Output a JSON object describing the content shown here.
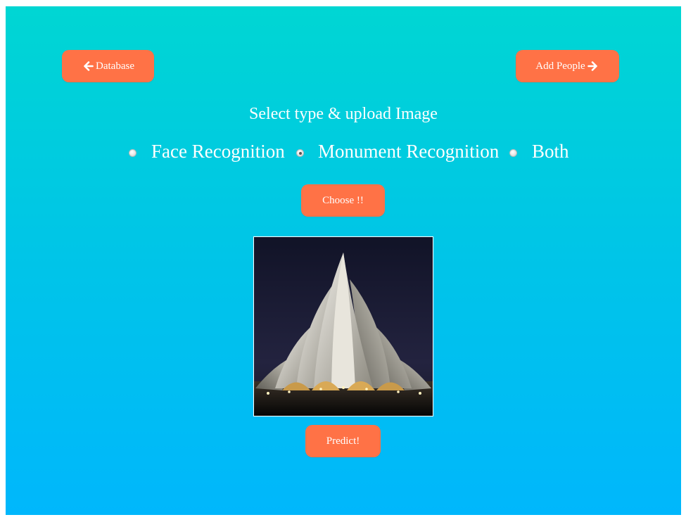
{
  "nav": {
    "database_label": "Database",
    "add_people_label": "Add People"
  },
  "main": {
    "heading": "Select type & upload Image",
    "options": [
      {
        "label": "Face Recognition",
        "checked": false
      },
      {
        "label": "Monument Recognition",
        "checked": true
      },
      {
        "label": "Both",
        "checked": false
      }
    ],
    "choose_label": "Choose !!",
    "predict_label": "Predict!"
  },
  "colors": {
    "button": "#ff7246",
    "gradient_top": "#00d6d3",
    "gradient_bottom": "#00b7fc"
  },
  "icons": {
    "back": "arrow-left-icon",
    "forward": "arrow-right-icon"
  }
}
